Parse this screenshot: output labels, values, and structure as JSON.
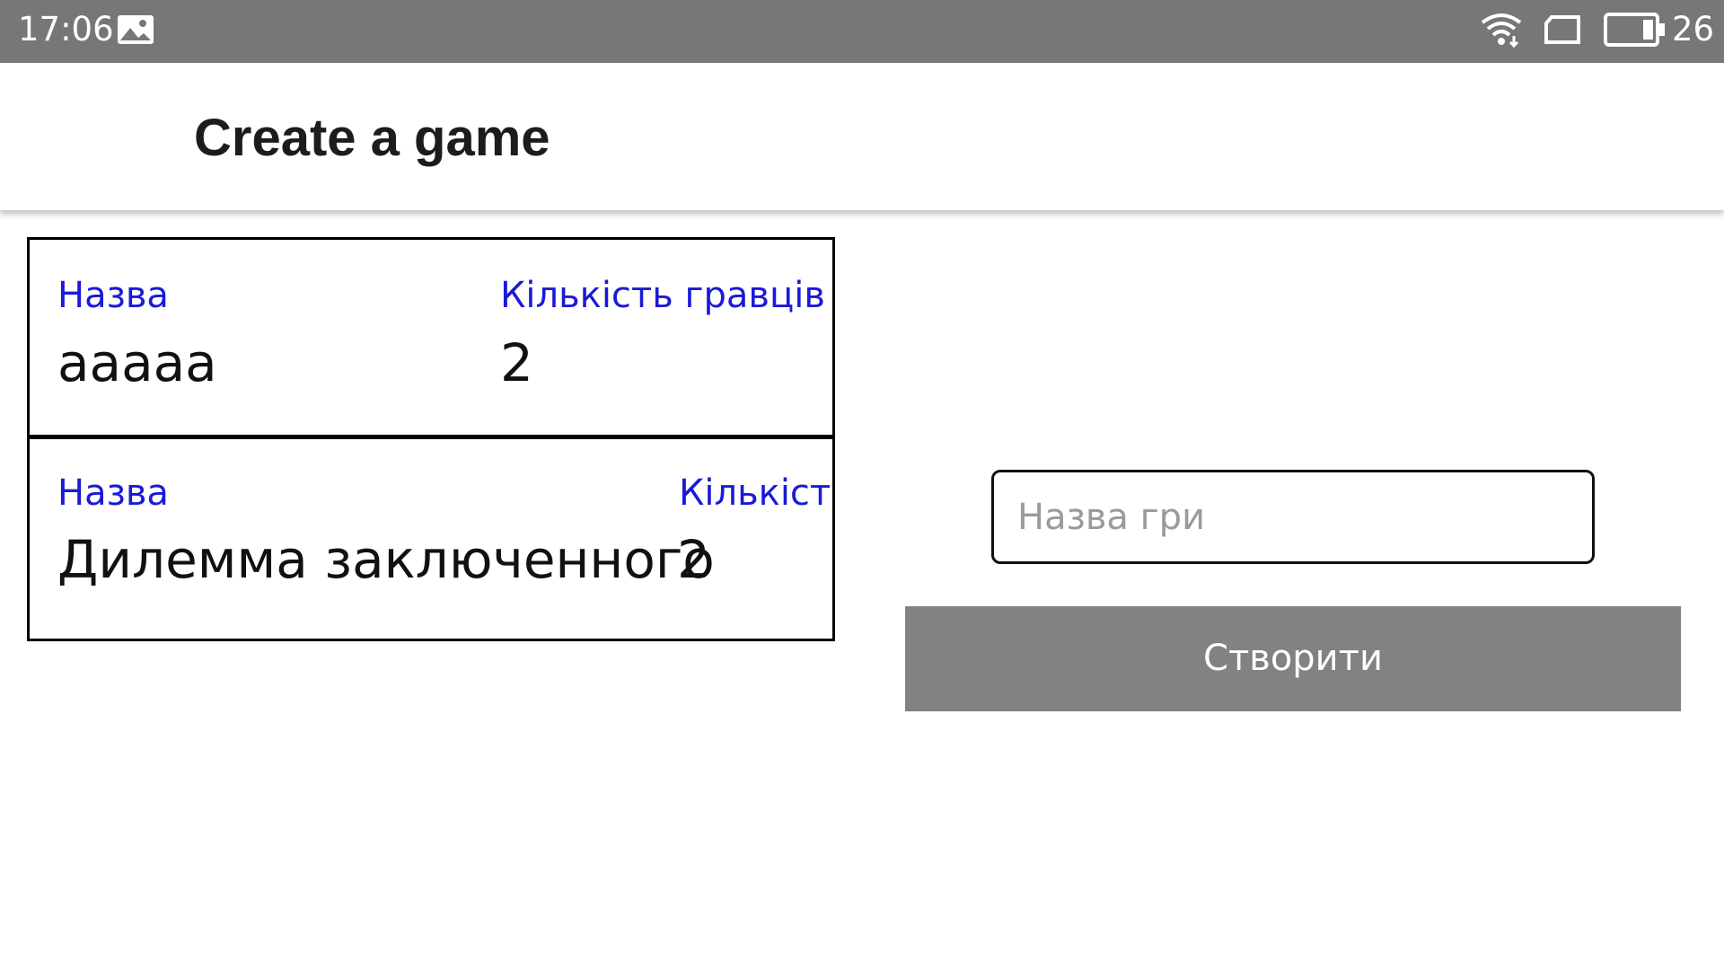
{
  "status_bar": {
    "time": "17:06",
    "battery_level": "26",
    "icons": [
      "gallery-notification-icon",
      "wifi-icon",
      "sim-card-icon",
      "battery-icon"
    ]
  },
  "app_bar": {
    "title": "Create a game"
  },
  "games": [
    {
      "name_label": "Назва",
      "name": "aaaaa",
      "players_label": "Кількість гравців",
      "players": "2"
    },
    {
      "name_label": "Назва",
      "name": "Дилемма заключенного",
      "players_label": "Кількість гравців",
      "players": "2"
    }
  ],
  "form": {
    "name_placeholder": "Назва гри",
    "name_value": "",
    "create_label": "Створити"
  },
  "colors": {
    "status_bar": "#777777",
    "label_blue": "#1a1ad6",
    "button_gray": "#828282"
  }
}
